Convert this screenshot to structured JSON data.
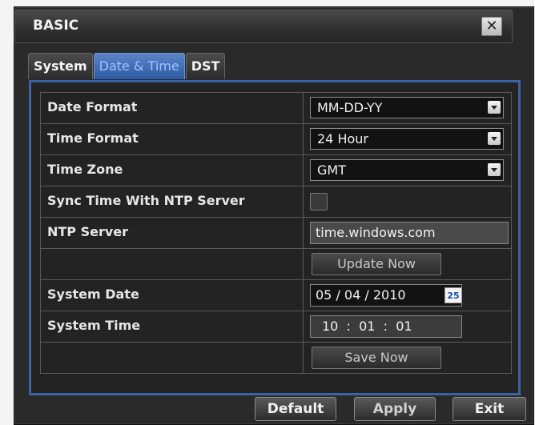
{
  "window": {
    "title": "BASIC",
    "close_label": "✕"
  },
  "tabs": [
    {
      "label": "System"
    },
    {
      "label": "Date & Time"
    },
    {
      "label": "DST"
    }
  ],
  "settings": {
    "date_format": {
      "label": "Date Format",
      "value": "MM-DD-YY"
    },
    "time_format": {
      "label": "Time Format",
      "value": "24 Hour"
    },
    "time_zone": {
      "label": "Time Zone",
      "value": "GMT"
    },
    "sync_ntp": {
      "label": "Sync Time With NTP Server",
      "checked": false
    },
    "ntp_server": {
      "label": "NTP Server",
      "value": "time.windows.com"
    },
    "update_now_label": "Update Now",
    "system_date": {
      "label": "System Date",
      "value": "05 / 04 / 2010",
      "calendar_icon_text": "25"
    },
    "system_time": {
      "label": "System Time",
      "value": "10  :  01  :  01"
    },
    "save_now_label": "Save Now"
  },
  "footer": {
    "default_label": "Default",
    "apply_label": "Apply",
    "exit_label": "Exit"
  },
  "colors": {
    "accent": "#3b62a8",
    "active_tab": "#2d5aa3",
    "background": "#232323"
  }
}
